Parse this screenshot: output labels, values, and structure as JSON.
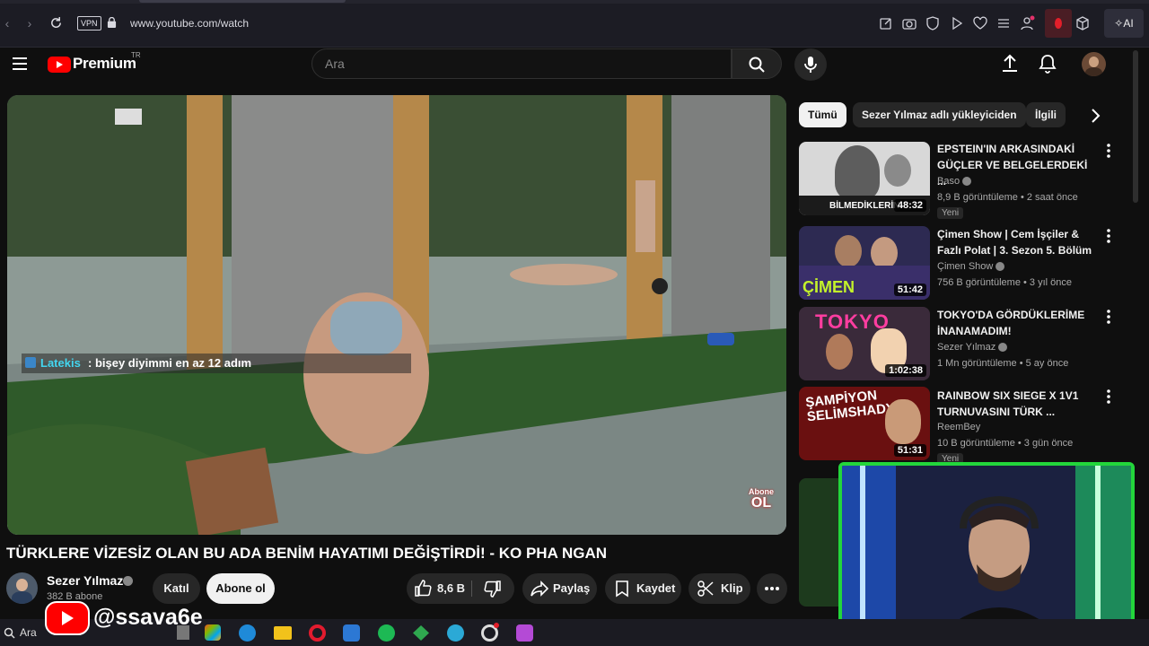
{
  "browser": {
    "url": "www.youtube.com/watch",
    "vpn_label": "VPN",
    "ai_label": "AI"
  },
  "header": {
    "brand": "Premium",
    "region": "TR",
    "search_placeholder": "Ara"
  },
  "video": {
    "chat_user": "Latekis",
    "chat_message": ": bişey diyimmi en az 12 adım",
    "subscribe_badge_line1": "Abone",
    "subscribe_badge_line2": "OL",
    "title": "TÜRKLERE VİZESİZ OLAN BU ADA BENİM HAYATIMI DEĞİŞTİRDİ! - KO PHA NGAN",
    "channel": "Sezer Yılmaz",
    "subscribers": "382 B abone",
    "join_label": "Katıl",
    "subscribe_label": "Abone ol",
    "likes": "8,6 B",
    "share_label": "Paylaş",
    "save_label": "Kaydet",
    "clip_label": "Klip"
  },
  "chips": [
    "Tümü",
    "Sezer Yılmaz adlı yükleyiciden",
    "İlgili"
  ],
  "related": [
    {
      "title": "EPSTEIN'IN ARKASINDAKİ GÜÇLER VE BELGELERDEKİ ...",
      "channel": "Baso",
      "meta": "8,9 B görüntüleme • 2 saat önce",
      "badge": "Yeni",
      "duration": "48:32",
      "thumb_text": "BİLMEDİKLERİN"
    },
    {
      "title": "Çimen Show | Cem İşçiler & Fazlı Polat | 3. Sezon 5. Bölüm",
      "channel": "Çimen Show",
      "meta": "756 B görüntüleme • 3 yıl önce",
      "duration": "51:42",
      "thumb_text": "ÇİMEN"
    },
    {
      "title": "TOKYO'DA GÖRDÜKLERİME İNANAMADIM!",
      "channel": "Sezer Yılmaz",
      "meta": "1 Mn görüntüleme • 5 ay önce",
      "duration": "1:02:38",
      "thumb_text": "TOKYO"
    },
    {
      "title": "RAINBOW SIX SIEGE X 1V1 TURNUVASINI TÜRK ...",
      "channel": "ReemBey",
      "meta": "10 B görüntüleme • 3 gün önce",
      "badge": "Yeni",
      "duration": "51:31",
      "thumb_text": "ŞAMPİYON SELİMSHADY"
    }
  ],
  "overlay": {
    "handle": "@ssava6e"
  },
  "taskbar": {
    "search_label": "Ara"
  },
  "colors": {
    "yt_red": "#ff0000",
    "webcam_border": "#23d63b",
    "chat_user": "#43d6f0"
  }
}
